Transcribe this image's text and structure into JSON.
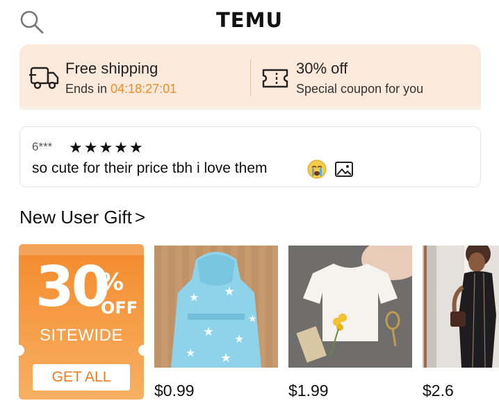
{
  "header": {
    "brand": "TEMU",
    "search_icon": "search-icon"
  },
  "promo": {
    "shipping": {
      "title": "Free shipping",
      "ends_label": "Ends in",
      "countdown": "04:18:27:01",
      "icon": "truck-icon"
    },
    "coupon": {
      "title": "30% off",
      "subtitle": "Special coupon for you",
      "icon": "coupon-icon"
    }
  },
  "review": {
    "reviewer": "6***",
    "stars": "★★★★★",
    "rating": 5,
    "text": "so cute for their price tbh i love them",
    "emoji_icon": "crying-face-icon",
    "photo_icon": "photo-icon"
  },
  "section": {
    "title": "New User Gift",
    "chevron": ">"
  },
  "gift_card": {
    "number": "30",
    "percent_sign": "%",
    "off_label": "OFF",
    "sitewide_label": "SITEWIDE",
    "button_label": "GET ALL"
  },
  "products": [
    {
      "price": "$0.99",
      "image": "blue-star-hooded-robe"
    },
    {
      "price": "$1.99",
      "image": "white-tshirt"
    },
    {
      "price": "$2.6",
      "image": "black-dress"
    }
  ],
  "colors": {
    "accent": "#f08a24",
    "promo_bg": "#fbeadb",
    "gift_gradient_top": "#f48a2c",
    "gift_gradient_bottom": "#f7b062"
  }
}
